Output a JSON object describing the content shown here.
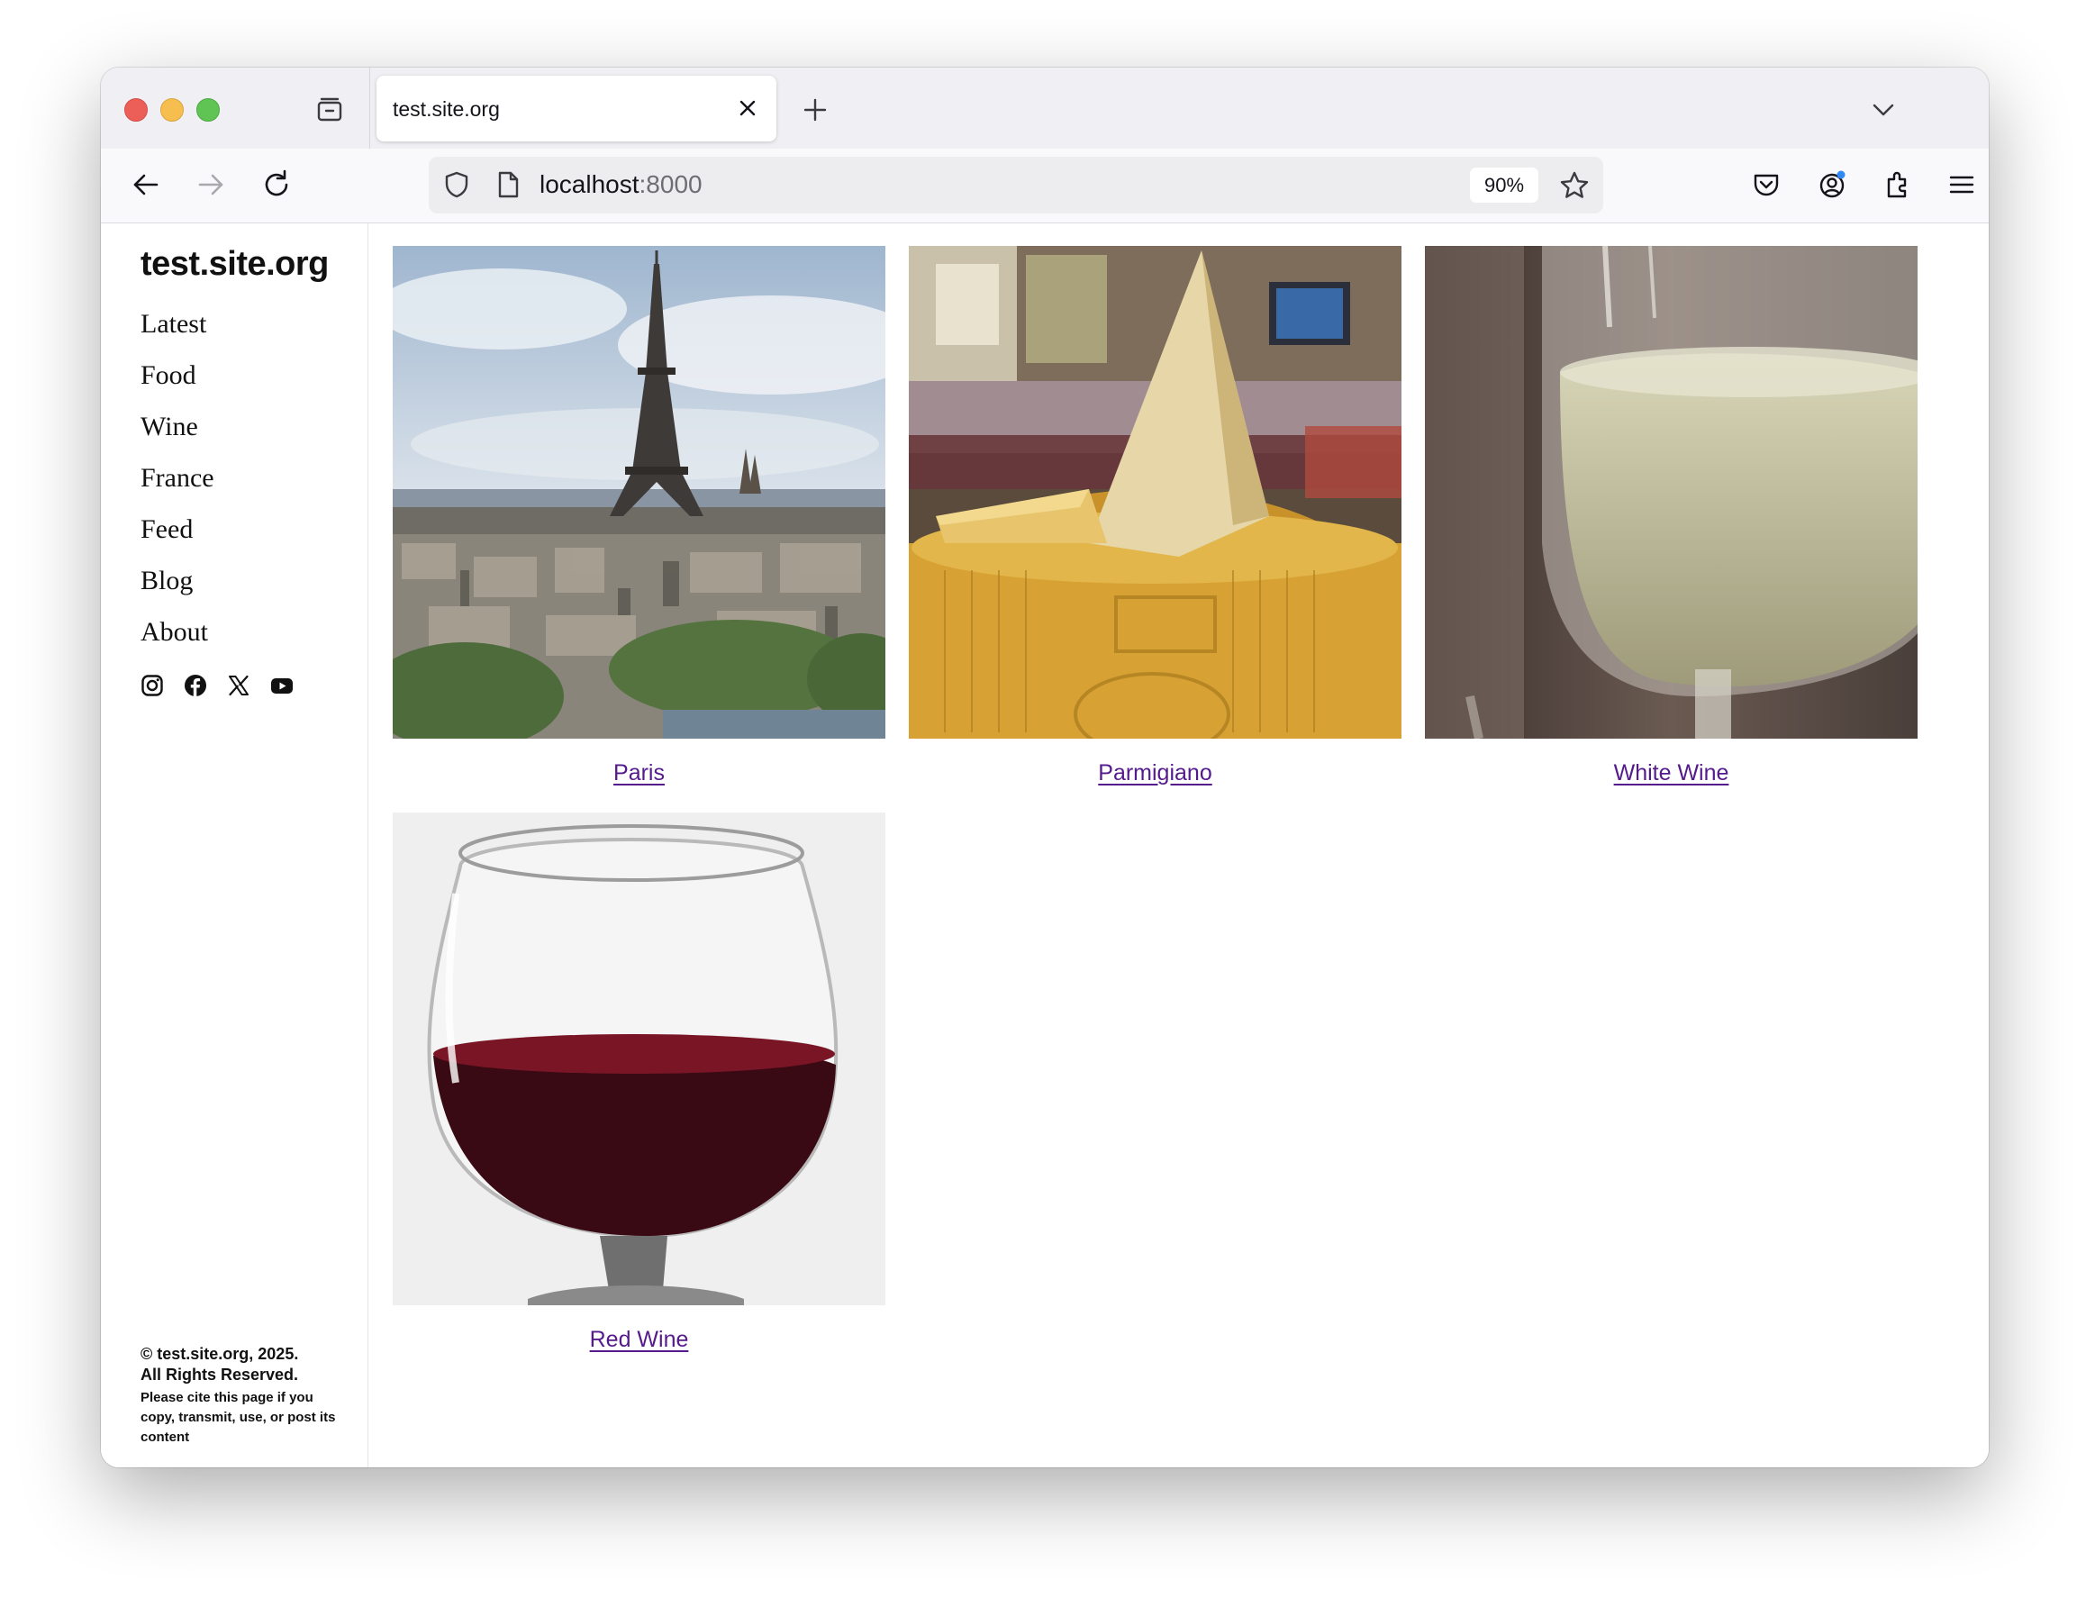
{
  "browser": {
    "tab_title": "test.site.org",
    "url_host": "localhost",
    "url_port": ":8000",
    "zoom": "90%"
  },
  "sidebar": {
    "site_title": "test.site.org",
    "menu": [
      {
        "label": "Latest"
      },
      {
        "label": "Food"
      },
      {
        "label": "Wine"
      },
      {
        "label": "France"
      },
      {
        "label": "Feed"
      },
      {
        "label": "Blog"
      },
      {
        "label": "About"
      }
    ],
    "social_icons": [
      "instagram-icon",
      "facebook-icon",
      "x-icon",
      "youtube-icon"
    ],
    "footer": {
      "copyright": "© test.site.org, 2025.",
      "rights": "All Rights Reserved.",
      "note": "Please cite this page if you copy, transmit, use, or post its content"
    }
  },
  "gallery": {
    "items": [
      {
        "label": "Paris",
        "image": "eiffel-tower-photo"
      },
      {
        "label": "Parmigiano",
        "image": "parmigiano-cheese-photo"
      },
      {
        "label": "White Wine",
        "image": "white-wine-glass-photo"
      },
      {
        "label": "Red Wine",
        "image": "red-wine-glass-photo"
      }
    ]
  },
  "colors": {
    "link_visited": "#551a8b",
    "toolbar_bg": "#f9f9fb",
    "tabstrip_bg": "#f0f0f4"
  }
}
